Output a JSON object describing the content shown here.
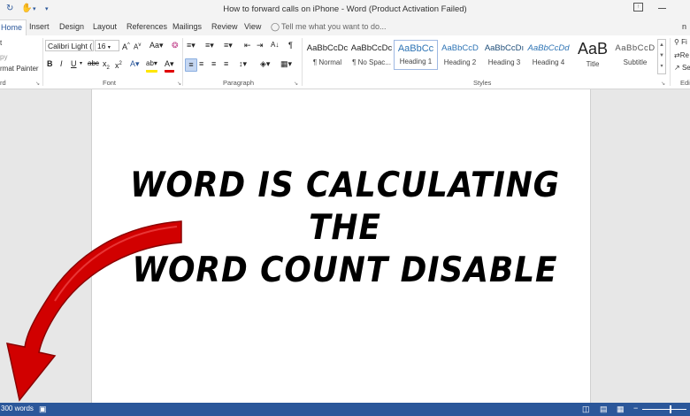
{
  "window": {
    "title": "How to forward calls on iPhone - Word (Product Activation Failed)"
  },
  "quick_access": {
    "save_icon": "save-icon",
    "undo_icon": "undo-icon"
  },
  "tabs": [
    "Home",
    "Insert",
    "Design",
    "Layout",
    "References",
    "Mailings",
    "Review",
    "View"
  ],
  "tell_me": "Tell me what you want to do...",
  "user_initial": "n",
  "clipboard": {
    "cut": "t",
    "copy": "py",
    "format_painter": "rmat Painter",
    "label": "rd"
  },
  "font": {
    "name": "Calibri Light (",
    "size": "16",
    "label": "Font"
  },
  "paragraph": {
    "label": "Paragraph"
  },
  "styles": {
    "label": "Styles",
    "items": [
      {
        "sample": "AaBbCcDc",
        "name": "¶ Normal"
      },
      {
        "sample": "AaBbCcDc",
        "name": "¶ No Spac..."
      },
      {
        "sample": "AaBbCc",
        "name": "Heading 1"
      },
      {
        "sample": "AaBbCcD",
        "name": "Heading 2"
      },
      {
        "sample": "AaBbCcDı",
        "name": "Heading 3"
      },
      {
        "sample": "AaBbCcDd",
        "name": "Heading 4"
      },
      {
        "sample": "AaB",
        "name": "Title"
      },
      {
        "sample": "AaBbCcD",
        "name": "Subtitle"
      }
    ]
  },
  "editing": {
    "find": "Fi",
    "replace": "Re",
    "select": "Se",
    "label": "Edi"
  },
  "headline": {
    "line1": "WORD IS CALCULATING THE",
    "line2": "WORD COUNT DISABLE"
  },
  "status": {
    "word_count": "300 words"
  },
  "colors": {
    "accent": "#2b579a",
    "arrow": "#d10000"
  }
}
